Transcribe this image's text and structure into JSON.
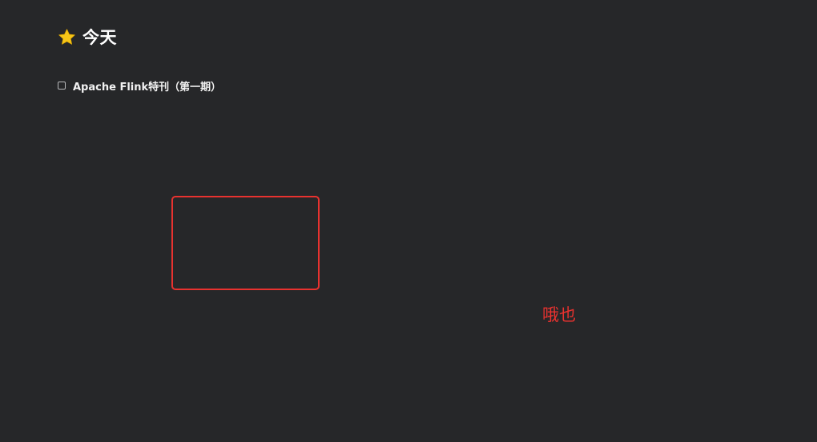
{
  "header": {
    "icon": "star-icon",
    "title": "今天"
  },
  "todos": [
    {
      "label": "Apache Flink特刊（第一期）",
      "checked": false
    }
  ],
  "annotation": {
    "text": "哦也",
    "color": "#e8322f"
  },
  "colors": {
    "background": "#262729",
    "star": "#f5c518",
    "annotation": "#e8322f"
  }
}
